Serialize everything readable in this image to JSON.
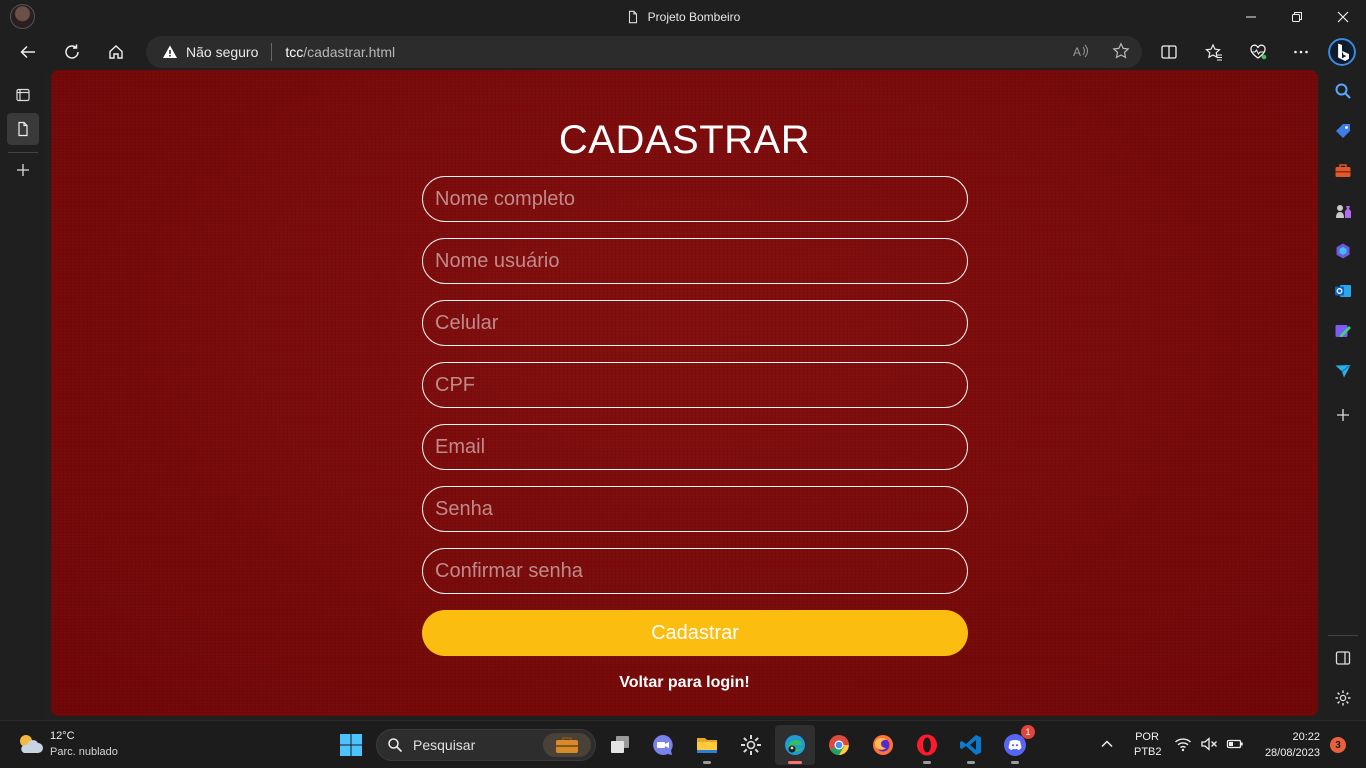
{
  "window": {
    "title": "Projeto Bombeiro"
  },
  "addressbar": {
    "security_label": "Não seguro",
    "url_host": "tcc",
    "url_path": "/cadastrar.html"
  },
  "page": {
    "heading": "CADASTRAR",
    "fields": {
      "nome_completo": "Nome completo",
      "nome_usuario": "Nome usuário",
      "celular": "Celular",
      "cpf": "CPF",
      "email": "Email",
      "senha": "Senha",
      "confirmar_senha": "Confirmar senha"
    },
    "submit_label": "Cadastrar",
    "back_link": "Voltar para login!",
    "colors": {
      "background": "#7d0a0a",
      "button": "#fbbd0f",
      "field_border": "#f2f2f2"
    }
  },
  "taskbar": {
    "weather_temp": "12°C",
    "weather_desc": "Parc. nublado",
    "search_placeholder": "Pesquisar",
    "discord_badge": "1",
    "lang_line1": "POR",
    "lang_line2": "PTB2",
    "time": "20:22",
    "date": "28/08/2023",
    "notifications": "3"
  }
}
